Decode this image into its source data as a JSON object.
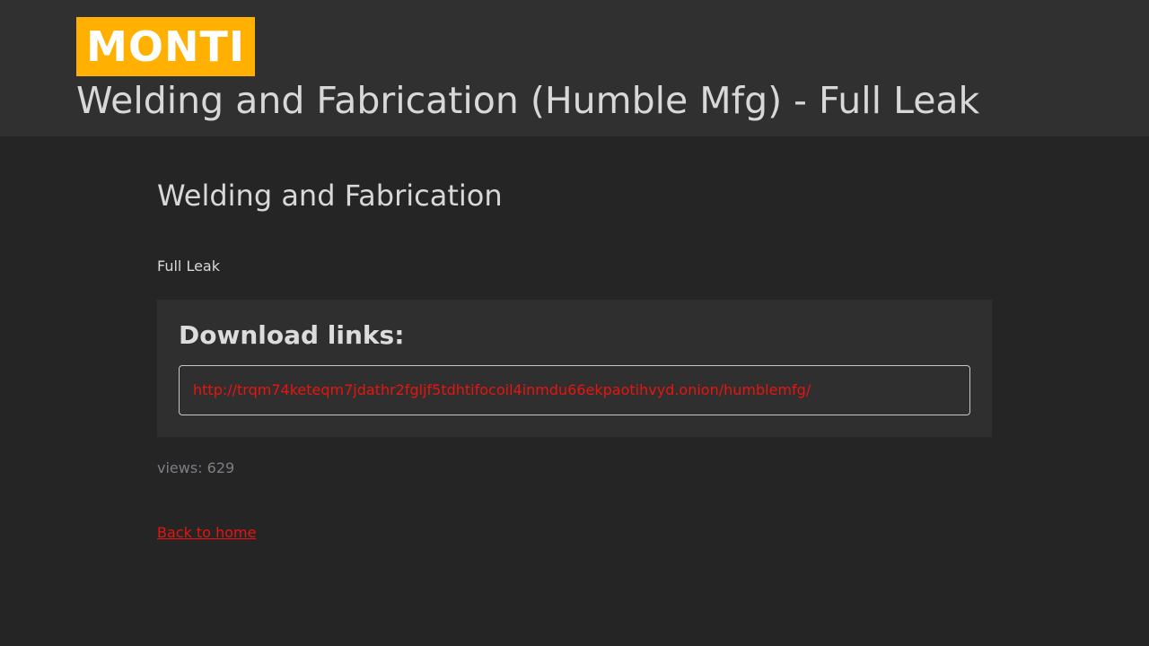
{
  "header": {
    "logo_text": "MONTI",
    "title": "Welding and Fabrication (Humble Mfg) - Full Leak"
  },
  "post": {
    "title": "Welding and Fabrication",
    "description": "Full Leak",
    "download": {
      "heading": "Download links:",
      "links": [
        "http://trqm74keteqm7jdathr2fgljf5tdhtifocoil4inmdu66ekpaotihvyd.onion/humblemfg/"
      ]
    },
    "views_text": "views: 629",
    "back_link_label": "Back to home"
  },
  "colors": {
    "page_background": "#252525",
    "header_background": "#303030",
    "logo_background": "#ffb000",
    "link_color": "#e8140f",
    "muted_text": "#7d7f84",
    "primary_text": "#d8d8d8"
  }
}
